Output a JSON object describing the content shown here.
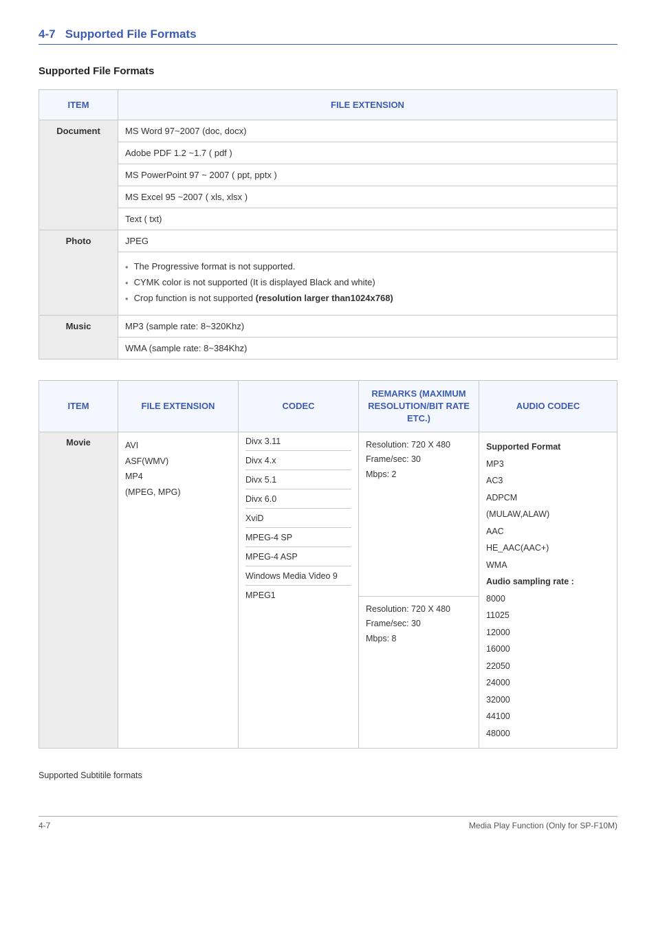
{
  "section_no": "4-7",
  "section_title": "Supported File Formats",
  "sub_heading": "Supported File Formats",
  "table1": {
    "head_item": "ITEM",
    "head_ext": "FILE EXTENSION",
    "rows": {
      "document_label": "Document",
      "doc1": "MS Word 97~2007 (doc, docx)",
      "doc2": "Adobe PDF 1.2 ~1.7 ( pdf )",
      "doc3": "MS PowerPoint 97 ~ 2007 ( ppt, pptx )",
      "doc4": "MS Excel 95 ~2007 ( xls, xlsx )",
      "doc5": "Text ( txt)",
      "photo_label": "Photo",
      "photo1": "JPEG",
      "photo2": "The Progressive format is not supported.",
      "photo3": "CYMK color is not supported (It is displayed Black and white)",
      "photo4_prefix": "Crop function is not supported ",
      "photo4_bold": "(resolution larger than1024x768)",
      "music_label": "Music",
      "music1": "MP3 (sample rate: 8~320Khz)",
      "music2": "WMA (sample rate: 8~384Khz)"
    }
  },
  "table2": {
    "head_item": "ITEM",
    "head_ext": "FILE EXTENSION",
    "head_codec": "CODEC",
    "head_remarks": "REMARKS (MAXIMUM RESOLUTION/BIT RATE ETC.)",
    "head_audio": "AUDIO CODEC",
    "movie_label": "Movie",
    "ext": {
      "l1": "AVI",
      "l2": "ASF(WMV)",
      "l3": "MP4",
      "l4": "(MPEG, MPG)"
    },
    "codec": {
      "c1": "Divx 3.11",
      "c2": "Divx 4.x",
      "c3": "Divx 5.1",
      "c4": "Divx 6.0",
      "c5": "XviD",
      "c6": "MPEG-4 SP",
      "c7": "MPEG-4 ASP",
      "c8": "Windows Media Video 9",
      "c9": "MPEG1"
    },
    "remarks": {
      "r1a": "Resolution: 720 X 480",
      "r1b": "Frame/sec: 30",
      "r1c": "Mbps: 2",
      "r2a": "Resolution: 720 X 480",
      "r2b": "Frame/sec: 30",
      "r2c": "Mbps: 8"
    },
    "audio": {
      "a0": "Supported Format",
      "a1": "MP3",
      "a2": "AC3",
      "a3": "ADPCM",
      "a4": "(MULAW,ALAW)",
      "a5": "AAC",
      "a6": "HE_AAC(AAC+)",
      "a7": "WMA",
      "a8": "Audio sampling rate :",
      "a9": "8000",
      "a10": "11025",
      "a11": "12000",
      "a12": "16000",
      "a13": "22050",
      "a14": "24000",
      "a15": "32000",
      "a16": "44100",
      "a17": "48000"
    }
  },
  "note": "Supported Subtitile formats",
  "footer_left": "4-7",
  "footer_right": "Media Play Function (Only for SP-F10M)"
}
